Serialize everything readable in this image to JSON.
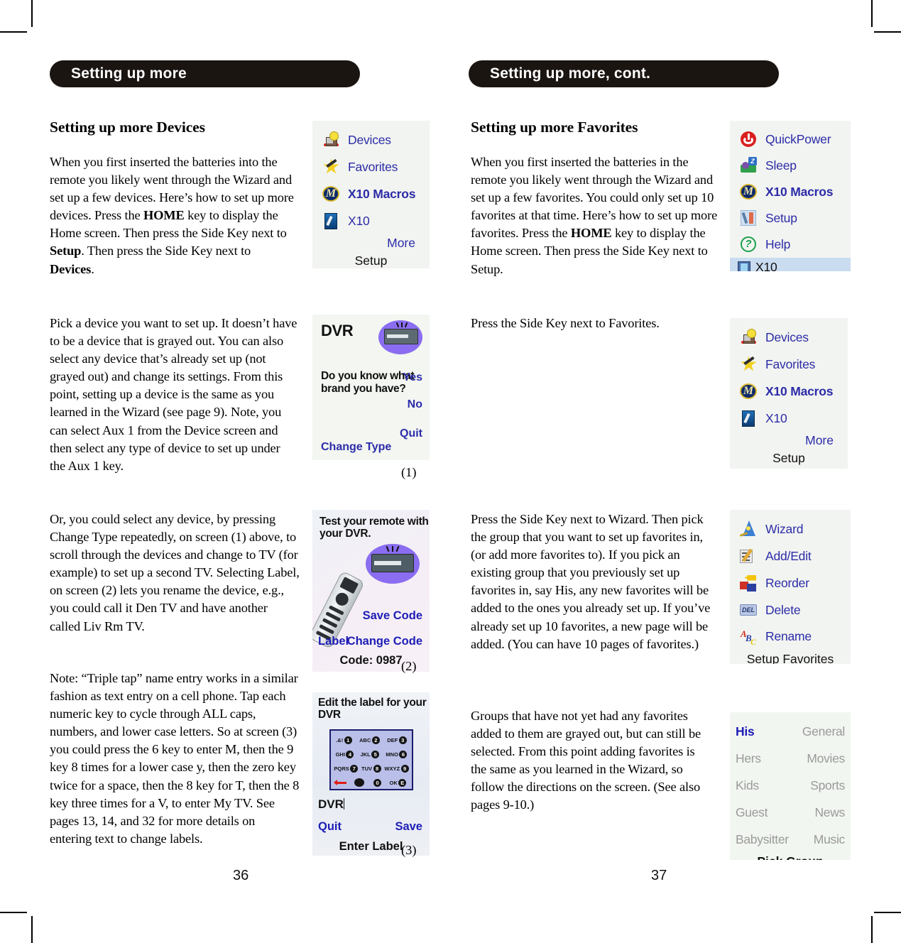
{
  "page": {
    "left_banner": "Setting up more",
    "right_banner": "Setting up more, cont.",
    "left_page_number": "36",
    "right_page_number": "37"
  },
  "left_column": {
    "title": "Setting up more Devices",
    "p1_a": "When you first inserted the batteries into the remote you likely went through the Wizard and set up a few devices. Here’s how to set up more devices. Press the ",
    "p1_home": "HOME",
    "p1_b": " key to display the Home screen. Then press the Side Key next to ",
    "p1_setup": "Setup",
    "p1_c": ". Then press the Side Key next to ",
    "p1_devices": "Devices",
    "p1_d": ".",
    "p2": "Pick a device you want to set up. It doesn’t have to be a device that is grayed out. You can also select any device that’s already set up (not grayed out) and change its settings. From this point, setting up a device is the same as you learned in the Wizard (see page 9). Note, you can select Aux 1 from the Device screen and then select any type of device to set up under the Aux 1 key.",
    "p3": "Or, you could select any device, by pressing Change Type repeatedly, on screen (1) above, to scroll through the devices and change to TV (for example) to set up a second TV. Selecting Label, on screen (2) lets you rename the device, e.g., you could call it Den TV and have another called Liv Rm TV.",
    "p4": "Note: “Triple tap” name entry works in a similar fashion as text entry on a cell phone. Tap each numeric key to cycle through ALL caps, numbers, and lower case letters. So at screen (3) you could press the 6 key to enter M, then the 9 key 8 times for a lower case y, then the zero key twice for a space, then the 8 key for T, then the 8 key three times for a V, to enter My TV. See pages 13, 14, and 32 for more details on entering text to change labels."
  },
  "right_column": {
    "title": "Setting up more Favorites",
    "p1_a": "When you first inserted the batteries in the remote you likely went through the Wizard and set up a few favorites. You could only set up 10 favorites at that time. Here’s how to set up more favorites. Press the ",
    "p1_home": "HOME",
    "p1_b": " key to display the Home screen. Then press the Side Key next to Setup.",
    "p2": "Press the Side Key next to Favorites.",
    "p3": "Press the Side Key next to Wizard. Then pick the group that you want to set up favorites in, (or add more favorites to). If you pick an existing group that you previously set up favorites in, say His, any new favorites will be added to the ones you already set up. If you’ve already set up 10 favorites, a new page will be added. (You can have 10 pages of favorites.)",
    "p4": "Groups that have not yet had any favorites added to them are grayed out, but can still be selected. From this point adding favorites is the same as you learned in the Wizard, so follow the directions on the screen. (See also pages 9-10.)"
  },
  "screens": {
    "home_setup_menu": {
      "items": [
        {
          "label": "Devices",
          "icon": "devices-icon",
          "bold": false,
          "selected": false
        },
        {
          "label": "Favorites",
          "icon": "favorites-icon",
          "bold": false,
          "selected": false
        },
        {
          "label": "X10 Macros",
          "icon": "x10-macros-icon",
          "bold": true,
          "selected": false
        },
        {
          "label": "X10",
          "icon": "x10-icon",
          "bold": false,
          "selected": false
        }
      ],
      "more_label": "More",
      "footer_label": "Setup"
    },
    "dvr_brand": {
      "caption": "(1)",
      "title": "DVR",
      "question": "Do you know what brand you have?",
      "yes": "Yes",
      "no": "No",
      "change_type": "Change Type",
      "quit": "Quit"
    },
    "test_remote": {
      "caption": "(2)",
      "title": "Test your remote with your DVR.",
      "save_code": "Save Code",
      "label": "Label",
      "change_code": "Change Code",
      "code": "Code: 0987"
    },
    "edit_label": {
      "caption": "(3)",
      "title": "Edit the label for your DVR",
      "value": "DVR",
      "quit": "Quit",
      "save": "Save",
      "footer": "Enter Label",
      "keypad": [
        [
          {
            "letters": ".&!",
            "num": "1"
          },
          {
            "letters": "ABC",
            "num": "2"
          },
          {
            "letters": "DEF",
            "num": "3"
          }
        ],
        [
          {
            "letters": "GHI",
            "num": "4"
          },
          {
            "letters": "JKL",
            "num": "5"
          },
          {
            "letters": "MNO",
            "num": "6"
          }
        ],
        [
          {
            "letters": "PQRS",
            "num": "7"
          },
          {
            "letters": "TUV",
            "num": "8"
          },
          {
            "letters": "WXYZ",
            "num": "9"
          }
        ],
        [
          {
            "letters": "",
            "num": "0"
          },
          {
            "letters": "OK",
            "num": "E"
          }
        ]
      ]
    },
    "quick_menu": {
      "items": [
        {
          "label": "QuickPower",
          "icon": "power-icon",
          "bold": false,
          "selected": false
        },
        {
          "label": "Sleep",
          "icon": "sleep-icon",
          "bold": false,
          "selected": false
        },
        {
          "label": "X10 Macros",
          "icon": "x10-macros-icon",
          "bold": true,
          "selected": false
        },
        {
          "label": "Setup",
          "icon": "setup-icon",
          "bold": false,
          "selected": false
        },
        {
          "label": "Help",
          "icon": "help-icon",
          "bold": false,
          "selected": false
        },
        {
          "label": "X10",
          "icon": "x10-small-icon",
          "bold": false,
          "selected": true
        }
      ]
    },
    "setup_favorites_menu": {
      "items": [
        {
          "label": "Wizard",
          "icon": "wizard-icon"
        },
        {
          "label": "Add/Edit",
          "icon": "add-edit-icon"
        },
        {
          "label": "Reorder",
          "icon": "reorder-icon"
        },
        {
          "label": "Delete",
          "icon": "delete-icon"
        },
        {
          "label": "Rename",
          "icon": "rename-icon"
        }
      ],
      "footer_label": "Setup Favorites"
    },
    "pick_group": {
      "rows": [
        {
          "left": "His",
          "left_active": true,
          "right": "General",
          "right_active": false
        },
        {
          "left": "Hers",
          "left_active": false,
          "right": "Movies",
          "right_active": false
        },
        {
          "left": "Kids",
          "left_active": false,
          "right": "Sports",
          "right_active": false
        },
        {
          "left": "Guest",
          "left_active": false,
          "right": "News",
          "right_active": false
        },
        {
          "left": "Babysitter",
          "left_active": false,
          "right": "Music",
          "right_active": false
        }
      ],
      "footer_label": "Pick Group"
    }
  }
}
